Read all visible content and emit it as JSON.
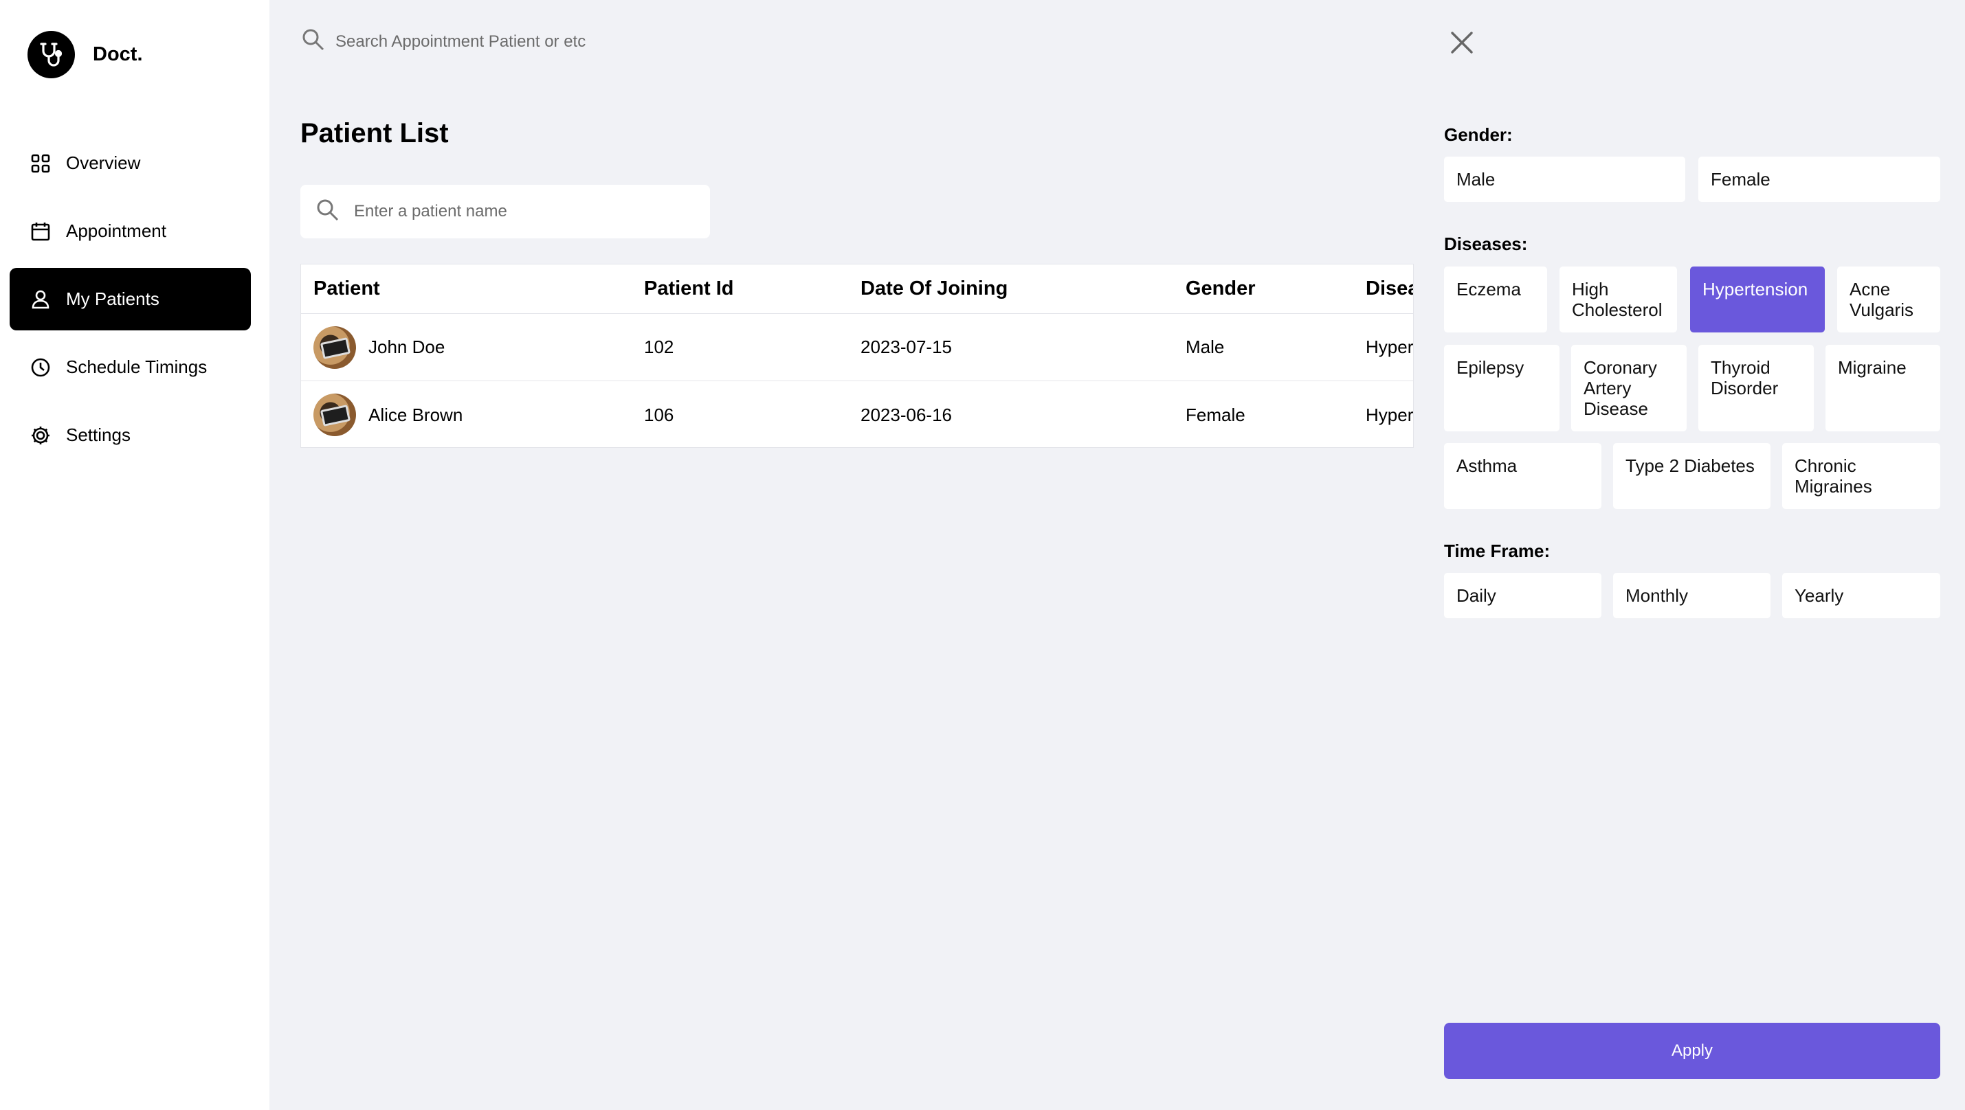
{
  "brand": {
    "name": "Doct.",
    "logo_icon": "stethoscope-icon"
  },
  "sidebar": {
    "items": [
      {
        "label": "Overview",
        "icon": "grid-icon",
        "active": false
      },
      {
        "label": "Appointment",
        "icon": "calendar-icon",
        "active": false
      },
      {
        "label": "My Patients",
        "icon": "user-icon",
        "active": true
      },
      {
        "label": "Schedule Timings",
        "icon": "clock-icon",
        "active": false
      },
      {
        "label": "Settings",
        "icon": "gear-icon",
        "active": false
      }
    ]
  },
  "header": {
    "search_placeholder": "Search Appointment Patient or etc"
  },
  "main": {
    "title": "Patient List",
    "patient_search_placeholder": "Enter a patient name",
    "table": {
      "columns": [
        "Patient",
        "Patient Id",
        "Date Of Joining",
        "Gender",
        "Disea"
      ],
      "rows": [
        {
          "patient": "John Doe",
          "id": "102",
          "date": "2023-07-15",
          "gender": "Male",
          "disease": "Hyper"
        },
        {
          "patient": "Alice Brown",
          "id": "106",
          "date": "2023-06-16",
          "gender": "Female",
          "disease": "Hyper"
        }
      ]
    }
  },
  "filter": {
    "gender_label": "Gender:",
    "gender_options": [
      "Male",
      "Female"
    ],
    "diseases_label": "Diseases:",
    "disease_options": [
      "Eczema",
      "High Cholesterol",
      "Hypertension",
      "Acne Vulgaris",
      "Epilepsy",
      "Coronary Artery Disease",
      "Thyroid Disorder",
      "Migraine",
      "Asthma",
      "Type 2 Diabetes",
      "Chronic Migraines"
    ],
    "selected_disease": "Hypertension",
    "timeframe_label": "Time Frame:",
    "timeframe_options": [
      "Daily",
      "Monthly",
      "Yearly"
    ],
    "apply_label": "Apply"
  },
  "colors": {
    "accent": "#6a58dc",
    "sidebar_active": "#000000",
    "background": "#f1f2f6"
  }
}
